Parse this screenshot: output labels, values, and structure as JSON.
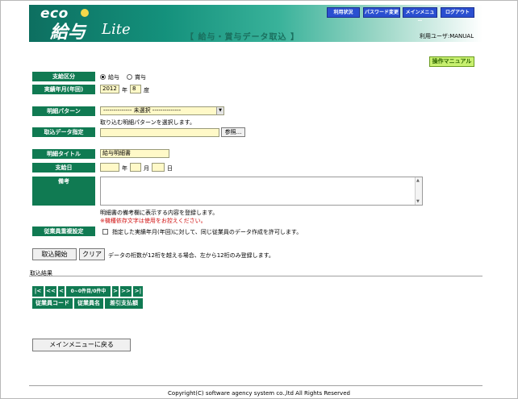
{
  "header": {
    "logo_eco": "eco",
    "logo_kyuyo": "給与",
    "logo_lite": "Lite",
    "page_title": "【 給与・賞与データ取込 】",
    "user_label": "利用ユーザ:",
    "user_name": "MANUAL",
    "nav": [
      "利用状況",
      "パスワード変更",
      "メインメニュー",
      "ログアウト"
    ]
  },
  "manual_button": "操作マニュアル",
  "form": {
    "pay_type": {
      "label": "支給区分",
      "options": [
        "給与",
        "賞与"
      ],
      "selected": "給与"
    },
    "period": {
      "label": "実績年月(年回)",
      "year": "2012",
      "year_unit": "年",
      "month": "8",
      "month_unit": "度"
    },
    "pattern": {
      "label": "明細パターン",
      "selected": "-------------- 未選択 --------------",
      "hint": "取り込む明細パターンを選択します。"
    },
    "file": {
      "label": "取込データ指定",
      "value": "",
      "browse": "参照..."
    },
    "title": {
      "label": "明細タイトル",
      "value": "給与明細書"
    },
    "pay_date": {
      "label": "支給日",
      "year_unit": "年",
      "month_unit": "月",
      "day_unit": "日"
    },
    "remarks": {
      "label": "備考",
      "hint": "明細書の備考欄に表示する内容を登録します。",
      "warning": "※機種依存文字は使用をお控えください。"
    },
    "duplicate": {
      "label": "従業員重複設定",
      "text": "指定した実績年月(年回)に対して、同じ従業員のデータ作成を許可します。"
    }
  },
  "actions": {
    "start": "取込開始",
    "clear": "クリア",
    "note": "データの桁数が12桁を越える場合、左から12桁のみ登録します。"
  },
  "results": {
    "title": "取込結果",
    "pager": [
      "|<",
      "<<",
      "<",
      "0~0件目/0件中",
      ">",
      ">>",
      ">|"
    ],
    "columns": [
      "従業員コード",
      "従業員名",
      "差引支払額"
    ]
  },
  "back_button": "メインメニューに戻る",
  "footer": "Copyright(C) software agency system co.,ltd All Rights Reserved",
  "colors": {
    "label_bg": "#107a52",
    "input_bg": "#fff9c8",
    "nav_bg": "#2a4fd0",
    "warning": "#d01010"
  }
}
